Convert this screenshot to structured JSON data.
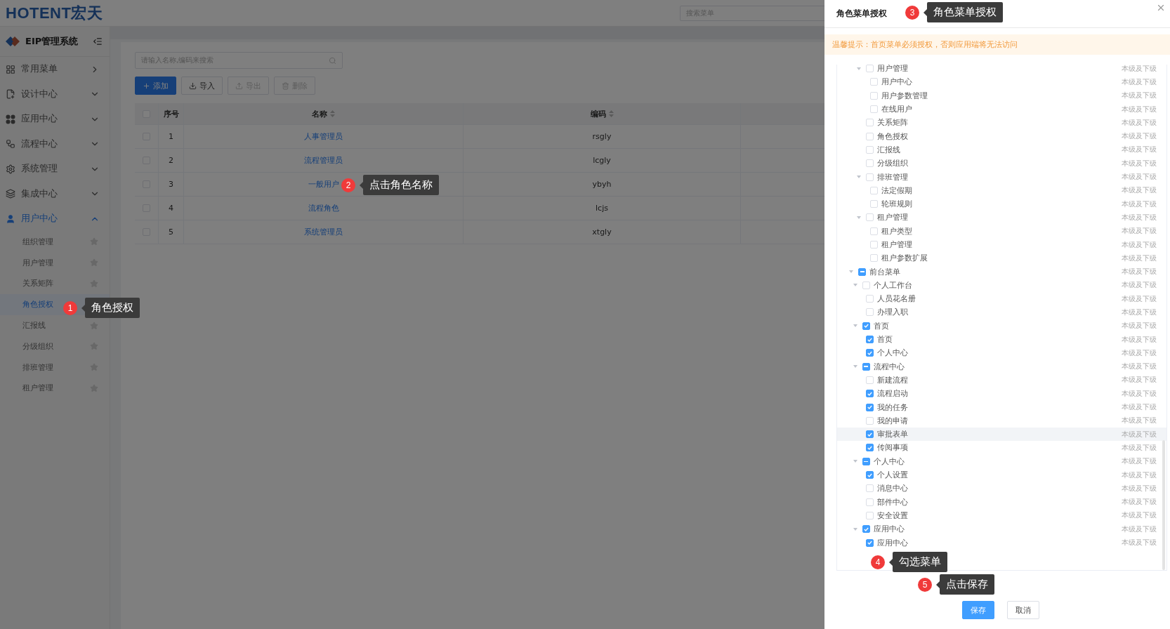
{
  "header": {
    "logo": "HOTENT宏天",
    "search": {
      "placeholder": "搜索菜单"
    }
  },
  "sidebar": {
    "title": "EIP管理系统",
    "items": [
      {
        "label": "常用菜单",
        "kind": "flyout",
        "expanded": false
      },
      {
        "label": "设计中心",
        "kind": "submenu",
        "expanded": false
      },
      {
        "label": "应用中心",
        "kind": "submenu",
        "expanded": false
      },
      {
        "label": "流程中心",
        "kind": "submenu",
        "expanded": false
      },
      {
        "label": "系统管理",
        "kind": "submenu",
        "expanded": false
      },
      {
        "label": "集成中心",
        "kind": "submenu",
        "expanded": false
      },
      {
        "label": "用户中心",
        "kind": "submenu",
        "expanded": true,
        "children": [
          {
            "label": "组织管理",
            "selected": false
          },
          {
            "label": "用户管理",
            "selected": false
          },
          {
            "label": "关系矩阵",
            "selected": false
          },
          {
            "label": "角色授权",
            "selected": true
          },
          {
            "label": "汇报线",
            "selected": false
          },
          {
            "label": "分级组织",
            "selected": false
          },
          {
            "label": "排班管理",
            "selected": false
          },
          {
            "label": "租户管理",
            "selected": false
          }
        ]
      }
    ]
  },
  "main": {
    "search": {
      "placeholder": "请输入名称,编码来搜索"
    },
    "toolbar": [
      {
        "label": "添加",
        "kind": "primary",
        "disabled": false
      },
      {
        "label": "导入",
        "kind": "default",
        "disabled": false
      },
      {
        "label": "导出",
        "kind": "default",
        "disabled": true
      },
      {
        "label": "删除",
        "kind": "default",
        "disabled": true
      }
    ],
    "table": {
      "all_checked": false,
      "columns": [
        {
          "label": "序号",
          "sortable": false
        },
        {
          "label": "名称",
          "sortable": true
        },
        {
          "label": "编码",
          "sortable": true
        }
      ],
      "rows": [
        {
          "checked": false,
          "cells": [
            "1",
            "人事管理员",
            "rsgly"
          ]
        },
        {
          "checked": false,
          "cells": [
            "2",
            "流程管理员",
            "lcgly"
          ]
        },
        {
          "checked": false,
          "cells": [
            "3",
            "一般用户",
            "ybyh"
          ]
        },
        {
          "checked": false,
          "cells": [
            "4",
            "流程角色",
            "lcjs"
          ]
        },
        {
          "checked": false,
          "cells": [
            "5",
            "系统管理员",
            "xtgly"
          ]
        }
      ]
    }
  },
  "drawer": {
    "title": "角色菜单授权",
    "warning": "温馨提示：首页菜单必须授权，否则应用端将无法访问",
    "tree": {
      "partial_nodes": [
        {
          "label": "用户管理",
          "scope": "本级及下级",
          "checked": false,
          "indeterminate": false,
          "highlighted": false,
          "expanded": true,
          "children": [
            {
              "label": "用户中心",
              "scope": "本级及下级",
              "checked": false,
              "indeterminate": false,
              "highlighted": false
            },
            {
              "label": "用户参数管理",
              "scope": "本级及下级",
              "checked": false,
              "indeterminate": false,
              "highlighted": false
            },
            {
              "label": "在线用户",
              "scope": "本级及下级",
              "checked": false,
              "indeterminate": false,
              "highlighted": false
            }
          ]
        },
        {
          "label": "关系矩阵",
          "scope": "本级及下级",
          "checked": false,
          "indeterminate": false,
          "highlighted": false
        },
        {
          "label": "角色授权",
          "scope": "本级及下级",
          "checked": false,
          "indeterminate": false,
          "highlighted": false
        },
        {
          "label": "汇报线",
          "scope": "本级及下级",
          "checked": false,
          "indeterminate": false,
          "highlighted": false
        },
        {
          "label": "分级组织",
          "scope": "本级及下级",
          "checked": false,
          "indeterminate": false,
          "highlighted": false
        },
        {
          "label": "排班管理",
          "scope": "本级及下级",
          "checked": false,
          "indeterminate": false,
          "highlighted": false,
          "expanded": true,
          "children": [
            {
              "label": "法定假期",
              "scope": "本级及下级",
              "checked": false,
              "indeterminate": false,
              "highlighted": false
            },
            {
              "label": "轮班规则",
              "scope": "本级及下级",
              "checked": false,
              "indeterminate": false,
              "highlighted": false
            }
          ]
        },
        {
          "label": "租户管理",
          "scope": "本级及下级",
          "checked": false,
          "indeterminate": false,
          "highlighted": false,
          "expanded": true,
          "children": [
            {
              "label": "租户类型",
              "scope": "本级及下级",
              "checked": false,
              "indeterminate": false,
              "highlighted": false
            },
            {
              "label": "租户管理",
              "scope": "本级及下级",
              "checked": false,
              "indeterminate": false,
              "highlighted": false
            },
            {
              "label": "租户参数扩展",
              "scope": "本级及下级",
              "checked": false,
              "indeterminate": false,
              "highlighted": false
            }
          ]
        }
      ],
      "nodes": [
        {
          "label": "前台菜单",
          "scope": "本级及下级",
          "checked": false,
          "indeterminate": true,
          "highlighted": false,
          "expanded": true,
          "children": [
            {
              "label": "个人工作台",
              "scope": "本级及下级",
              "checked": false,
              "indeterminate": false,
              "highlighted": false,
              "expanded": true,
              "children": [
                {
                  "label": "人员花名册",
                  "scope": "本级及下级",
                  "checked": false,
                  "indeterminate": false,
                  "highlighted": false
                },
                {
                  "label": "办理入职",
                  "scope": "本级及下级",
                  "checked": false,
                  "indeterminate": false,
                  "highlighted": false
                }
              ]
            },
            {
              "label": "首页",
              "scope": "本级及下级",
              "checked": true,
              "indeterminate": false,
              "highlighted": false,
              "expanded": true,
              "children": [
                {
                  "label": "首页",
                  "scope": "本级及下级",
                  "checked": true,
                  "indeterminate": false,
                  "highlighted": false
                },
                {
                  "label": "个人中心",
                  "scope": "本级及下级",
                  "checked": true,
                  "indeterminate": false,
                  "highlighted": false
                }
              ]
            },
            {
              "label": "流程中心",
              "scope": "本级及下级",
              "checked": false,
              "indeterminate": true,
              "highlighted": false,
              "expanded": true,
              "children": [
                {
                  "label": "新建流程",
                  "scope": "本级及下级",
                  "checked": false,
                  "indeterminate": false,
                  "highlighted": false
                },
                {
                  "label": "流程启动",
                  "scope": "本级及下级",
                  "checked": true,
                  "indeterminate": false,
                  "highlighted": false
                },
                {
                  "label": "我的任务",
                  "scope": "本级及下级",
                  "checked": true,
                  "indeterminate": false,
                  "highlighted": false
                },
                {
                  "label": "我的申请",
                  "scope": "本级及下级",
                  "checked": false,
                  "indeterminate": false,
                  "highlighted": false
                },
                {
                  "label": "审批表单",
                  "scope": "本级及下级",
                  "checked": true,
                  "indeterminate": false,
                  "highlighted": true
                },
                {
                  "label": "传阅事项",
                  "scope": "本级及下级",
                  "checked": true,
                  "indeterminate": false,
                  "highlighted": false
                }
              ]
            },
            {
              "label": "个人中心",
              "scope": "本级及下级",
              "checked": false,
              "indeterminate": true,
              "highlighted": false,
              "expanded": true,
              "children": [
                {
                  "label": "个人设置",
                  "scope": "本级及下级",
                  "checked": true,
                  "indeterminate": false,
                  "highlighted": false
                },
                {
                  "label": "消息中心",
                  "scope": "本级及下级",
                  "checked": false,
                  "indeterminate": false,
                  "highlighted": false
                },
                {
                  "label": "部件中心",
                  "scope": "本级及下级",
                  "checked": false,
                  "indeterminate": false,
                  "highlighted": false
                },
                {
                  "label": "安全设置",
                  "scope": "本级及下级",
                  "checked": false,
                  "indeterminate": false,
                  "highlighted": false
                }
              ]
            },
            {
              "label": "应用中心",
              "scope": "本级及下级",
              "checked": true,
              "indeterminate": false,
              "highlighted": false,
              "expanded": true,
              "children": [
                {
                  "label": "应用中心",
                  "scope": "本级及下级",
                  "checked": true,
                  "indeterminate": false,
                  "highlighted": false
                }
              ]
            }
          ]
        }
      ]
    },
    "buttons": [
      {
        "label": "保存",
        "kind": "primary"
      },
      {
        "label": "取消",
        "kind": "default"
      }
    ]
  },
  "annotations": [
    {
      "number": "1",
      "text": "角色授权"
    },
    {
      "number": "2",
      "text": "点击角色名称"
    },
    {
      "number": "3",
      "text": "角色菜单授权"
    },
    {
      "number": "4",
      "text": "勾选菜单"
    },
    {
      "number": "5",
      "text": "点击保存"
    }
  ]
}
